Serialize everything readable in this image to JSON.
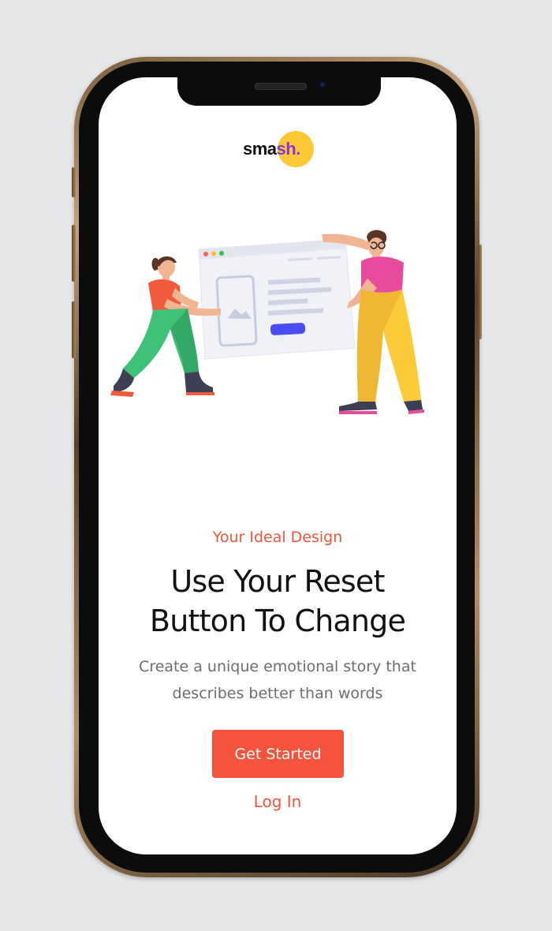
{
  "logo": {
    "text_prefix": "sma",
    "text_accent": "sh.",
    "circle_color": "#fdc936",
    "accent_color": "#8a35d6"
  },
  "hero": {
    "eyebrow": "Your Ideal Design",
    "title_line1": "Use Your Reset",
    "title_line2": "Button To Change",
    "subtitle_line1": "Create a unique emotional story that",
    "subtitle_line2": "describes better than words"
  },
  "actions": {
    "primary_label": "Get Started",
    "secondary_label": "Log In"
  },
  "colors": {
    "accent": "#f5533d",
    "background": "#e6e7e9",
    "screen": "#ffffff"
  },
  "illustration": {
    "icon": "people-holding-browser-window-illustration"
  }
}
